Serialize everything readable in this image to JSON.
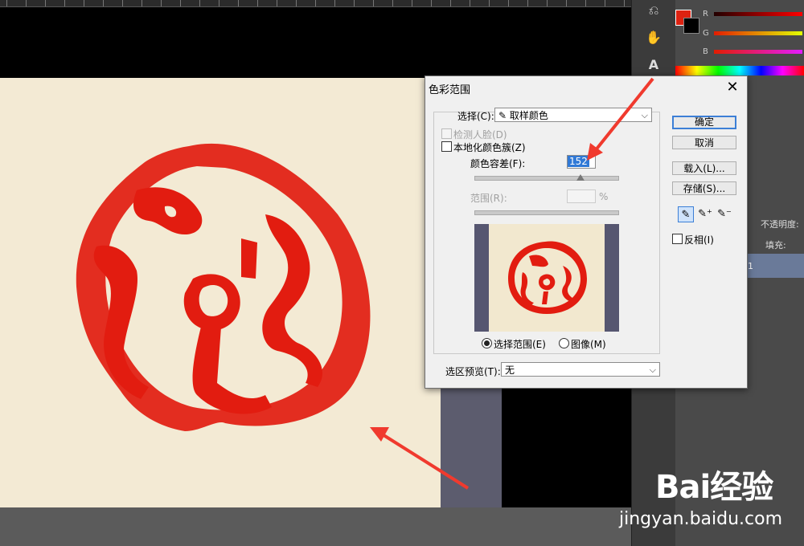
{
  "colors": {
    "seal_red": "#e21c10",
    "paper": "#f3ead4",
    "accent": "#3079d6"
  },
  "dialog": {
    "title": "色彩范围",
    "select_label": "选择(C):",
    "select_value": "取样颜色",
    "detect_faces_label": "检测人脸(D)",
    "localized_clusters_label": "本地化颜色簇(Z)",
    "fuzziness_label": "颜色容差(F):",
    "fuzziness_value": "152",
    "fuzziness_level": 0.74,
    "range_label": "范围(R):",
    "range_unit": "%",
    "radio_selection_label": "选择范围(E)",
    "radio_image_label": "图像(M)",
    "selection_preview_label": "选区预览(T):",
    "selection_preview_value": "无",
    "ok_label": "确定",
    "cancel_label": "取消",
    "load_label": "载入(L)...",
    "save_label": "存储(S)...",
    "invert_label": "反相(I)"
  },
  "panel": {
    "slider_r": "R",
    "slider_g": "G",
    "slider_b": "B",
    "opacity_label": "不透明度:",
    "fill_label": "填充:",
    "layer_number": "1"
  },
  "icons": {
    "close": "close-icon",
    "eyedropper": "eyedropper-icon",
    "eyedropper_add": "eyedropper-plus-icon",
    "eyedropper_subtract": "eyedropper-minus-icon"
  },
  "watermark": {
    "brand": "Bai经验",
    "url": "jingyan.baidu.com"
  }
}
